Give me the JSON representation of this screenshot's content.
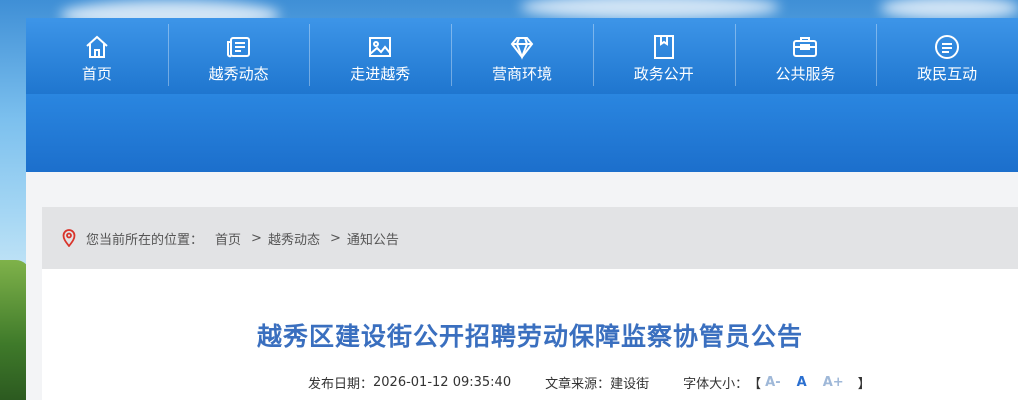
{
  "nav": {
    "items": [
      {
        "label": "首页",
        "icon": "home-icon"
      },
      {
        "label": "越秀动态",
        "icon": "newspaper-icon"
      },
      {
        "label": "走进越秀",
        "icon": "picture-icon"
      },
      {
        "label": "营商环境",
        "icon": "diamond-icon"
      },
      {
        "label": "政务公开",
        "icon": "folder-icon"
      },
      {
        "label": "公共服务",
        "icon": "briefcase-icon"
      },
      {
        "label": "政民互动",
        "icon": "chat-icon"
      }
    ]
  },
  "breadcrumb": {
    "prefix": "您当前所在的位置：",
    "items": [
      "首页",
      "越秀动态",
      "通知公告"
    ],
    "separator": ">"
  },
  "article": {
    "title": "越秀区建设街公开招聘劳动保障监察协管员公告",
    "date_label": "发布日期：",
    "date_value": "2026-01-12 09:35:40",
    "source_label": "文章来源：",
    "source_value": "建设街",
    "font_size_label": "字体大小：",
    "bracket_open": "【",
    "font_small": "A-",
    "font_normal": "A",
    "font_large": "A+",
    "bracket_close": "】"
  },
  "colors": {
    "nav_top": "#3d95e8",
    "nav_bottom": "#1f76cf",
    "title": "#3a6fbf",
    "pin": "#d9342b"
  }
}
